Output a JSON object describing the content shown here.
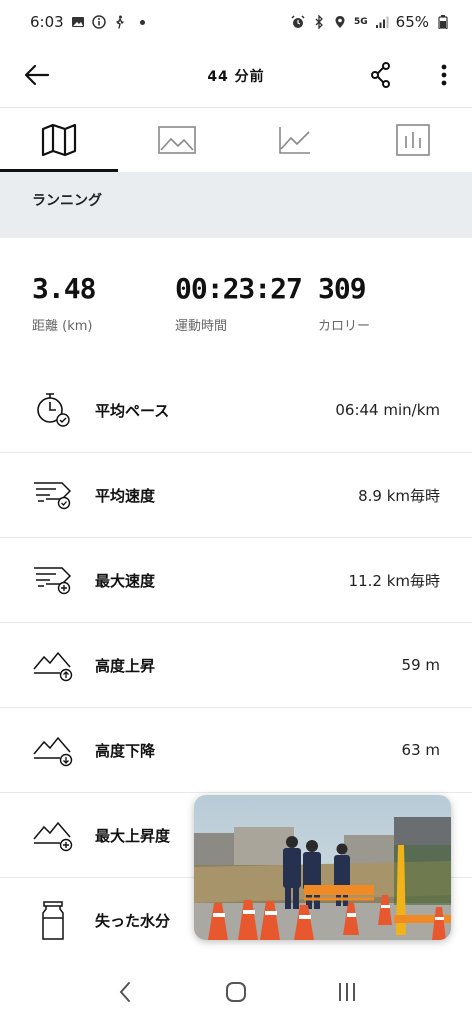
{
  "status_bar": {
    "time": "6:03",
    "battery": "65%",
    "network": "5G"
  },
  "header": {
    "title": "44 分前",
    "back_icon": "arrow-left-icon",
    "share_icon": "share-icon",
    "more_icon": "more-vertical-icon"
  },
  "tabs": [
    {
      "icon": "map-icon",
      "active": true
    },
    {
      "icon": "image-icon",
      "active": false
    },
    {
      "icon": "line-chart-icon",
      "active": false
    },
    {
      "icon": "bar-chart-icon",
      "active": false
    }
  ],
  "activity": {
    "type": "ランニング"
  },
  "metrics": {
    "distance": {
      "value": "3.48",
      "label": "距離 (km)"
    },
    "duration": {
      "value": "00:23:27",
      "label": "運動時間"
    },
    "calories": {
      "value": "309",
      "label": "カロリー"
    }
  },
  "rows": [
    {
      "icon": "stopwatch-icon",
      "label": "平均ペース",
      "value": "06:44 min/km"
    },
    {
      "icon": "speed-average-icon",
      "label": "平均速度",
      "value": "8.9 km毎時"
    },
    {
      "icon": "speed-max-icon",
      "label": "最大速度",
      "value": "11.2 km毎時"
    },
    {
      "icon": "elevation-up-icon",
      "label": "高度上昇",
      "value": "59 m"
    },
    {
      "icon": "elevation-down-icon",
      "label": "高度下降",
      "value": "63 m"
    },
    {
      "icon": "max-incline-icon",
      "label": "最大上昇度",
      "value": ""
    },
    {
      "icon": "water-bottle-icon",
      "label": "失った水分",
      "value": ""
    }
  ],
  "colors": {
    "band": "#eaedf0",
    "text": "#111111",
    "muted": "#666666",
    "divider": "#e8e8e8"
  }
}
